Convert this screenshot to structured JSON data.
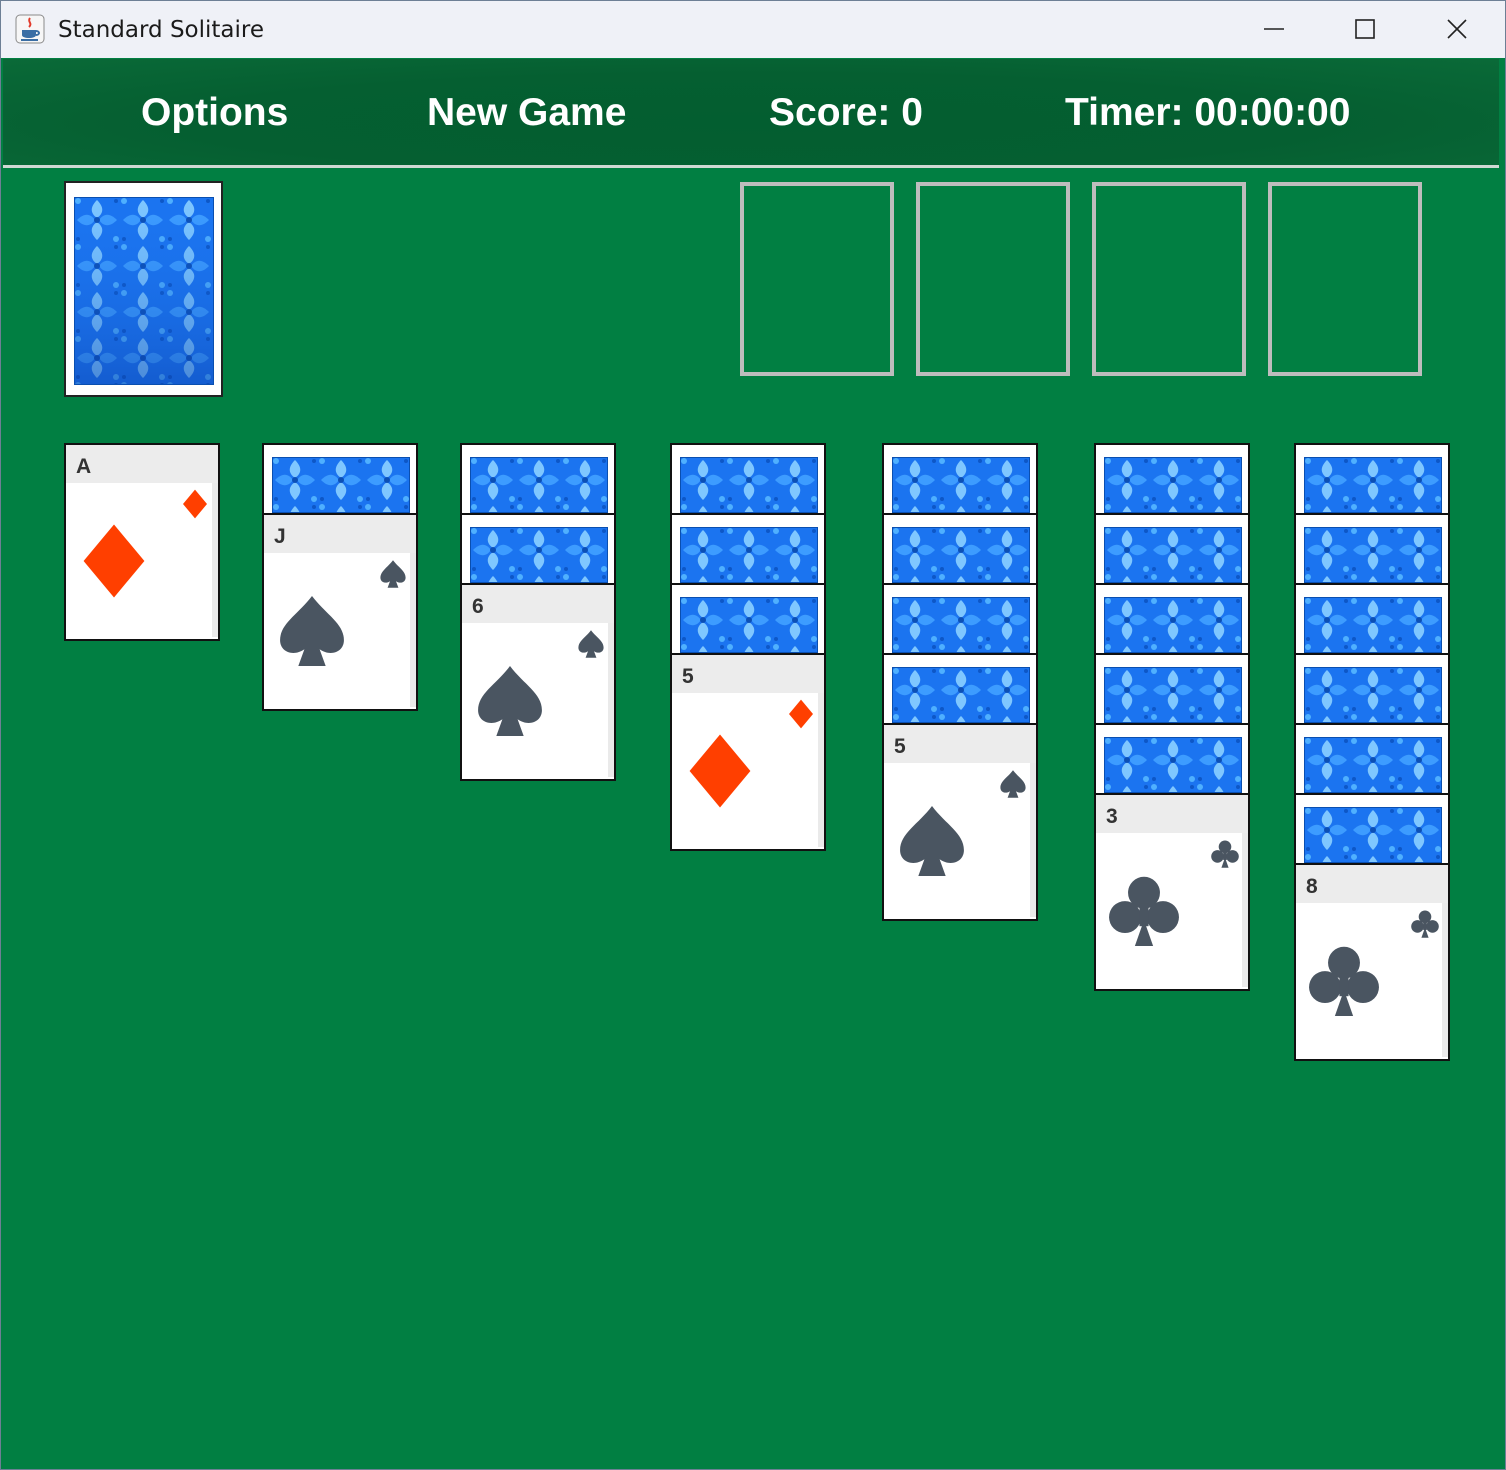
{
  "window": {
    "title": "Standard Solitaire"
  },
  "menu": {
    "options_label": "Options",
    "new_game_label": "New Game",
    "score_text": "Score: 0",
    "timer_text": "Timer: 00:00:00"
  },
  "colors": {
    "felt": "#017f42",
    "menubar": "#055f31",
    "red_suit": "#ff3f00",
    "black_suit": "#4a5561",
    "card_back": "#1f7fff",
    "foundation_outline": "#bdbdbd"
  },
  "stock": {
    "face": "down",
    "icon": "card-back-pattern"
  },
  "foundations": [
    {
      "slot": 1,
      "state": "empty"
    },
    {
      "slot": 2,
      "state": "empty"
    },
    {
      "slot": 3,
      "state": "empty"
    },
    {
      "slot": 4,
      "state": "empty"
    }
  ],
  "tableau": [
    {
      "column": 1,
      "hidden_count": 0,
      "top_card": {
        "rank": "A",
        "suit": "diamonds",
        "color": "red"
      }
    },
    {
      "column": 2,
      "hidden_count": 1,
      "top_card": {
        "rank": "J",
        "suit": "spades",
        "color": "black"
      }
    },
    {
      "column": 3,
      "hidden_count": 2,
      "top_card": {
        "rank": "6",
        "suit": "spades",
        "color": "black"
      }
    },
    {
      "column": 4,
      "hidden_count": 3,
      "top_card": {
        "rank": "5",
        "suit": "diamonds",
        "color": "red"
      }
    },
    {
      "column": 5,
      "hidden_count": 4,
      "top_card": {
        "rank": "5",
        "suit": "spades",
        "color": "black"
      }
    },
    {
      "column": 6,
      "hidden_count": 5,
      "top_card": {
        "rank": "3",
        "suit": "clubs",
        "color": "black"
      }
    },
    {
      "column": 7,
      "hidden_count": 6,
      "top_card": {
        "rank": "8",
        "suit": "clubs",
        "color": "black"
      }
    }
  ]
}
